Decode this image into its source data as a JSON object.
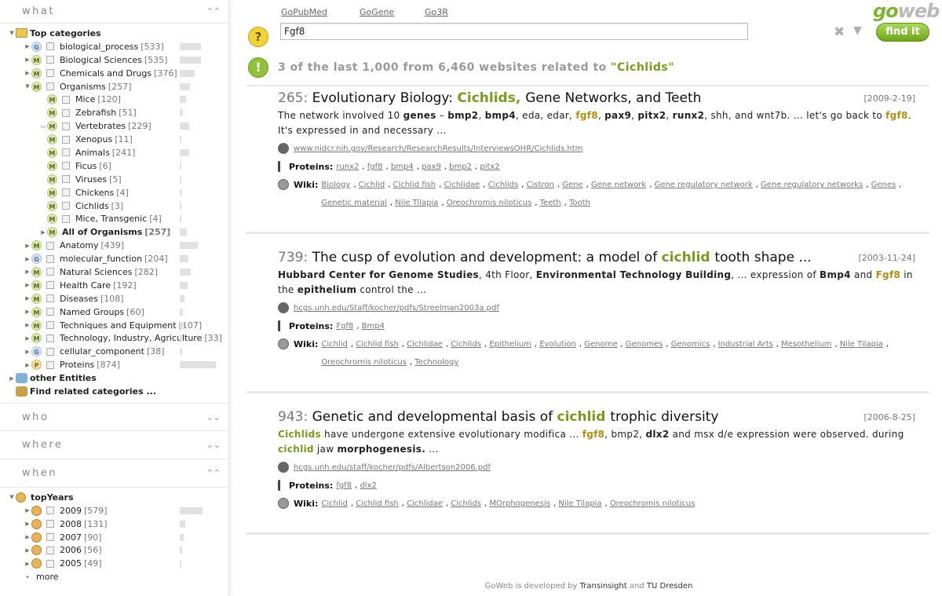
{
  "sidebar": {
    "what": {
      "title": "what",
      "toggle": "⌃⌃",
      "top": "Top categories",
      "items": [
        {
          "icon": "G",
          "label": "biological_process",
          "count": "[533]",
          "bar": 27
        },
        {
          "icon": "M",
          "label": "Biological Sciences",
          "count": "[535]",
          "bar": 27
        },
        {
          "icon": "M",
          "label": "Chemicals and Drugs",
          "count": "[376]",
          "bar": 19
        },
        {
          "icon": "M",
          "label": "Organisms",
          "count": "[257]",
          "bar": 13
        }
      ],
      "organisms": [
        {
          "label": "Mice",
          "count": "[120]",
          "bar": 8
        },
        {
          "label": "Zebrafish",
          "count": "[51]",
          "bar": 4
        },
        {
          "label": "Vertebrates",
          "count": "[229]",
          "bar": 12
        },
        {
          "label": "Xenopus",
          "count": "[11]",
          "bar": 2
        },
        {
          "label": "Animals",
          "count": "[241]",
          "bar": 12
        },
        {
          "label": "Ficus",
          "count": "[6]",
          "bar": 2
        },
        {
          "label": "Viruses",
          "count": "[5]",
          "bar": 2
        },
        {
          "label": "Chickens",
          "count": "[4]",
          "bar": 2
        },
        {
          "label": "Cichlids",
          "count": "[3]",
          "bar": 2
        },
        {
          "label": "Mice, Transgenic",
          "count": "[4]",
          "bar": 2
        }
      ],
      "all_organisms": {
        "label": "All of Organisms",
        "count": "[257]",
        "bar": 9
      },
      "rest": [
        {
          "icon": "M",
          "label": "Anatomy",
          "count": "[439]",
          "bar": 23
        },
        {
          "icon": "G",
          "label": "molecular_function",
          "count": "[204]",
          "bar": 11
        },
        {
          "icon": "M",
          "label": "Natural Sciences",
          "count": "[282]",
          "bar": 14
        },
        {
          "icon": "M",
          "label": "Health Care",
          "count": "[192]",
          "bar": 10
        },
        {
          "icon": "M",
          "label": "Diseases",
          "count": "[108]",
          "bar": 6
        },
        {
          "icon": "M",
          "label": "Named Groups",
          "count": "[60]",
          "bar": 4
        },
        {
          "icon": "M",
          "label": "Techniques and Equipment",
          "count": "[107]",
          "bar": 6
        },
        {
          "icon": "M",
          "label": "Technology, Industry, Agriculture",
          "count": "[33]",
          "bar": 3
        },
        {
          "icon": "G",
          "label": "cellular_component",
          "count": "[38]",
          "bar": 3
        },
        {
          "icon": "P",
          "label": "Proteins",
          "count": "[874]",
          "bar": 46
        }
      ],
      "other": "other Entities",
      "find": "Find related categories ..."
    },
    "who": {
      "title": "who",
      "toggle": "⌄⌄"
    },
    "where": {
      "title": "where",
      "toggle": "⌄⌄"
    },
    "when": {
      "title": "when",
      "toggle": "⌃⌃",
      "top": "topYears",
      "years": [
        {
          "label": "2009",
          "count": "[579]",
          "bar": 29
        },
        {
          "label": "2008",
          "count": "[131]",
          "bar": 7
        },
        {
          "label": "2007",
          "count": "[90]",
          "bar": 5
        },
        {
          "label": "2006",
          "count": "[56]",
          "bar": 3
        },
        {
          "label": "2005",
          "count": "[49]",
          "bar": 2
        }
      ],
      "more": "more"
    }
  },
  "header": {
    "links": [
      "GoPubMed",
      "GoGene",
      "Go3R"
    ],
    "search_value": "Fgf8",
    "find_label": "find it",
    "logo_a": "go",
    "logo_b": "web"
  },
  "summary": {
    "prefix": "3 of the last 1,000 from 6,460 websites related to ",
    "query": "\"Cichlids\""
  },
  "results": [
    {
      "num": "265:",
      "date": "[2009-2-19]",
      "title": [
        [
          "Evolutionary ",
          ""
        ],
        [
          "Biology: ",
          "b"
        ],
        [
          "Cichlids, ",
          "hl"
        ],
        [
          "Gene ",
          "b"
        ],
        [
          "Networks, ",
          "b"
        ],
        [
          "and ",
          ""
        ],
        [
          "Teeth",
          "b"
        ]
      ],
      "snippet": [
        [
          "The network involved 10 ",
          ""
        ],
        [
          "genes",
          "b"
        ],
        [
          " – ",
          ""
        ],
        [
          "bmp2",
          "b"
        ],
        [
          ", ",
          ""
        ],
        [
          "bmp4",
          "b"
        ],
        [
          ", eda, edar, ",
          ""
        ],
        [
          "fgf8",
          "hl"
        ],
        [
          ", ",
          ""
        ],
        [
          "pax9",
          "b"
        ],
        [
          ", ",
          ""
        ],
        [
          "pitx2",
          "b"
        ],
        [
          ", ",
          ""
        ],
        [
          "runx2",
          "b"
        ],
        [
          ", shh, and wnt7b. ... let's go back to ",
          ""
        ],
        [
          "fgf8",
          "hl"
        ],
        [
          ". It's expressed in and necessary ...",
          ""
        ]
      ],
      "url": "www.nidcr.nih.gov/Research/ResearchResults/InterviewsOHR/Cichlids.htm",
      "proteins_label": "Proteins:",
      "proteins": [
        "runx2",
        "fgf8",
        "bmp4",
        "pax9",
        "bmp2",
        "pitx2"
      ],
      "wiki_label": "Wiki:",
      "wiki": [
        "Biology",
        "Cichlid",
        "Cichlid fish",
        "Cichlidae",
        "Cichlids",
        "Cistron",
        "Gene",
        "Gene network",
        "Gene regulatory network",
        "Gene regulatory networks",
        "Genes",
        "Genetic material",
        "Nile Tilapia",
        "Oreochromis niloticus",
        "Teeth",
        "Tooth"
      ]
    },
    {
      "num": "739:",
      "date": "[2003-11-24]",
      "title": [
        [
          "The cusp of ",
          ""
        ],
        [
          "evolution ",
          "b"
        ],
        [
          "and development: a model of ",
          ""
        ],
        [
          "cichlid ",
          "hl"
        ],
        [
          "tooth shape ...",
          ""
        ]
      ],
      "snippet": [
        [
          "Hubbard Center for Genome Studies",
          "b"
        ],
        [
          ", 4th Floor, ",
          ""
        ],
        [
          "Environmental Technology Building",
          "b"
        ],
        [
          ", ... expression of ",
          ""
        ],
        [
          "Bmp4",
          "b"
        ],
        [
          " and ",
          ""
        ],
        [
          "Fgf8",
          "hl"
        ],
        [
          " in the ",
          ""
        ],
        [
          "epithelium",
          "b"
        ],
        [
          " control the ...",
          ""
        ]
      ],
      "url": "hcgs.unh.edu/Staff/kocher/pdfs/Streelman2003a.pdf",
      "proteins_label": "Proteins:",
      "proteins": [
        "Fgf8",
        "Bmp4"
      ],
      "wiki_label": "Wiki:",
      "wiki": [
        "Cichlid",
        "Cichlid fish",
        "Cichlidae",
        "Cichlids",
        "Epithelium",
        "Evolution",
        "Genome",
        "Genomes",
        "Genomics",
        "Industrial Arts",
        "Mesothelium",
        "Nile Tilapia",
        "Oreochromis niloticus",
        "Technology"
      ]
    },
    {
      "num": "943:",
      "date": "[2006-8-25]",
      "title": [
        [
          "Genetic and developmental basis of ",
          ""
        ],
        [
          "cichlid ",
          "hl"
        ],
        [
          "trophic diversity",
          ""
        ]
      ],
      "snippet": [
        [
          "Cichlids",
          "hlg"
        ],
        [
          " have undergone extensive evolutionary modifica ... ",
          ""
        ],
        [
          "fgf8",
          "hl"
        ],
        [
          ", bmp2, ",
          ""
        ],
        [
          "dlx2",
          "b"
        ],
        [
          " and msx d/e expression were observed. during ",
          ""
        ],
        [
          "cichlid",
          "hlg"
        ],
        [
          " jaw ",
          ""
        ],
        [
          "morphogenesis.",
          "b"
        ],
        [
          " ...",
          ""
        ]
      ],
      "url": "hcgs.unh.edu/staff/kocher/pdfs/Albertson2006.pdf",
      "proteins_label": "Proteins:",
      "proteins": [
        "fgf8",
        "dlx2"
      ],
      "wiki_label": "Wiki:",
      "wiki": [
        "Cichlid",
        "Cichlid fish",
        "Cichlidae",
        "Cichlids",
        "MOrphogenesis",
        "Nile Tilapia",
        "Oreochromis niloticus"
      ]
    }
  ],
  "footer": {
    "a": "GoWeb is developed by ",
    "b": "Transinsight",
    "c": " and ",
    "d": "TU Dresden"
  },
  "colors": {
    "accent": "#7a9a1f",
    "highlight": "#b08f14",
    "button": "#8fc23a"
  }
}
